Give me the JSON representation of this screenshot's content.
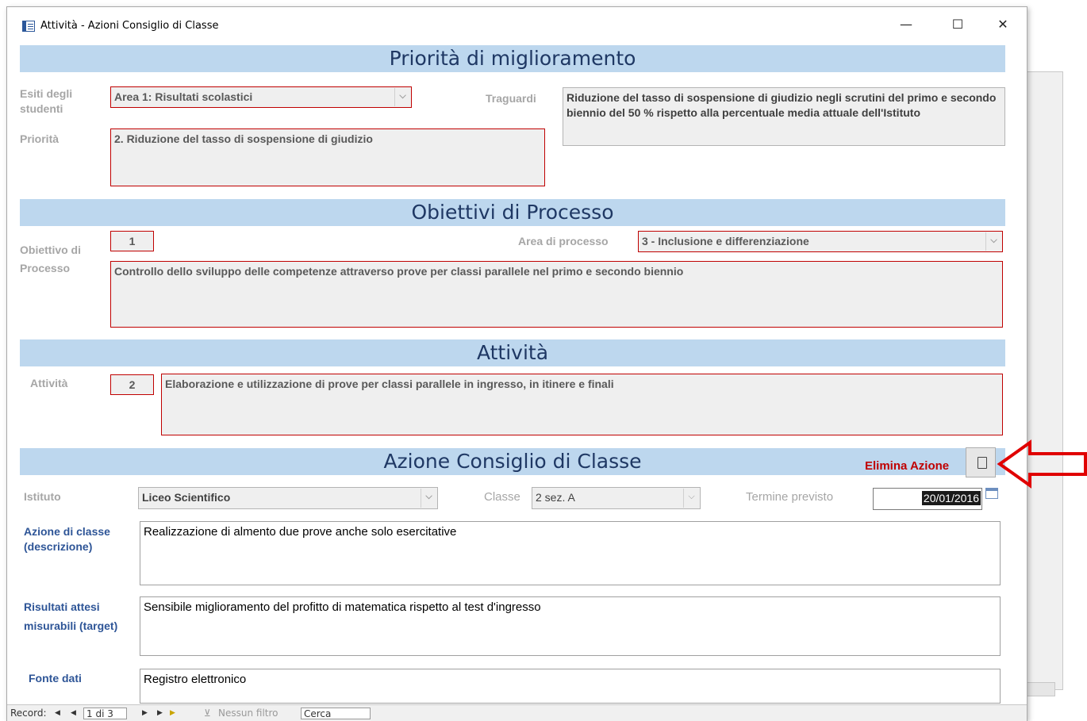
{
  "window": {
    "title": "Attività - Azioni Consiglio di Classe",
    "minimize": "—",
    "maximize": "☐",
    "close": "✕"
  },
  "sections": {
    "priorita": "Priorità di miglioramento",
    "obiettivi": "Obiettivi di Processo",
    "attivita": "Attività",
    "azione": "Azione Consiglio di Classe"
  },
  "priorita": {
    "esiti_label": "Esiti degli studenti",
    "esiti_value": "Area 1: Risultati scolastici",
    "priorita_label": "Priorità",
    "priorita_value": "2. Riduzione del tasso di sospensione di giudizio",
    "traguardi_label": "Traguardi",
    "traguardi_value": "Riduzione del tasso di sospensione di giudizio negli scrutini del primo e secondo biennio del 50 % rispetto alla percentuale media attuale dell'Istituto"
  },
  "obiettivo": {
    "label": "Obiettivo di Processo",
    "number": "1",
    "area_label": "Area di processo",
    "area_value": "3 - Inclusione e differenziazione",
    "description": "Controllo dello sviluppo delle competenze attraverso prove per classi parallele nel primo e secondo biennio"
  },
  "attivita": {
    "label": "Attività",
    "number": "2",
    "description": "Elaborazione e utilizzazione di prove per classi parallele in ingresso, in itinere e finali"
  },
  "azione": {
    "elimina_label": "Elimina Azione",
    "istituto_label": "Istituto",
    "istituto_value": "Liceo Scientifico",
    "classe_label": "Classe",
    "classe_value": "2 sez. A",
    "termine_label": "Termine previsto",
    "termine_value": "20/01/2016",
    "descrizione_label": "Azione di classe (descrizione)",
    "descrizione_value": "Realizzazione di almento due prove anche solo esercitative",
    "risultati_label": "Risultati attesi misurabili (target)",
    "risultati_value": "Sensibile miglioramento del profitto di matematica rispetto al test d'ingresso",
    "fonte_label": "Fonte dati",
    "fonte_value": "Registro elettronico"
  },
  "record_nav": {
    "record_label": "Record:",
    "first": "◀",
    "prev": "◀",
    "position": "1 di 3",
    "next": "▶",
    "last": "▶",
    "new": "▶",
    "filter": "Nessun filtro",
    "search": "Cerca"
  },
  "colors": {
    "banner": "#bdd7ee",
    "banner_text": "#1f3864",
    "required_border": "#c00000",
    "arrow": "#e00000"
  }
}
